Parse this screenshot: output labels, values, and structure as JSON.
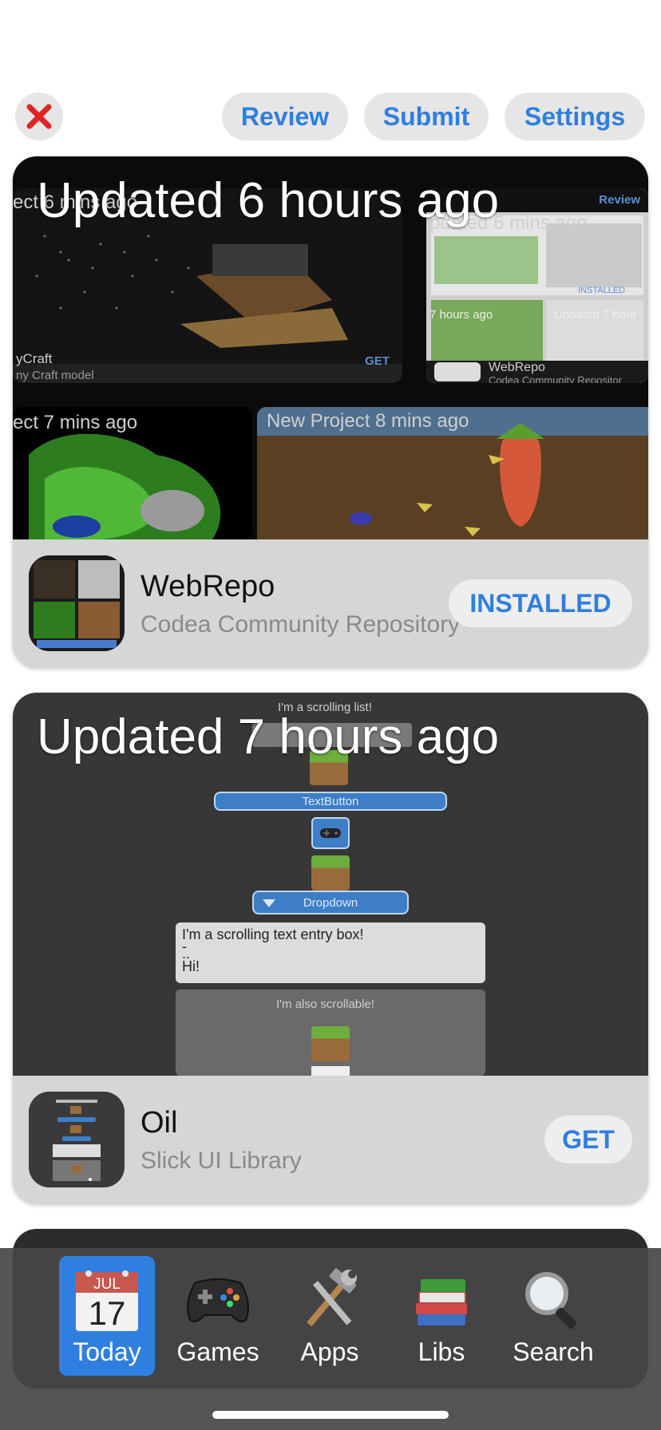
{
  "topbar": {
    "review_label": "Review",
    "submit_label": "Submit",
    "settings_label": "Settings",
    "close_icon": "close-x-icon",
    "accent": "#2f7fe0",
    "close_color": "#e02424"
  },
  "cards": [
    {
      "hero_title": "Updated 6 hours ago",
      "app_name": "WebRepo",
      "app_subtitle": "Codea Community Repository",
      "action_label": "INSTALLED",
      "hero": {
        "tile1_label": "ect 6 mins ago",
        "tile1_app": "yCraft",
        "tile1_sub": "ny Craft model",
        "tile1_get": "GET",
        "tile2_label": "pdated 6 mins ago",
        "tile2_badge": "Review",
        "tile2_app": "WebRepo",
        "tile2_sub": "Codea Community Repositor",
        "tile2_installed": "INSTALLED",
        "tile2_small1": "7 hours ago",
        "tile2_small2": "Updated 7 hour",
        "tile3_label": "ect 7 mins ago",
        "tile4_label": "New Project 8 mins ago"
      }
    },
    {
      "hero_title": "Updated 7 hours ago",
      "app_name": "Oil",
      "app_subtitle": "Slick UI Library",
      "action_label": "GET",
      "hero": {
        "scroll_list_label": "I'm a scrolling list!",
        "text_button_label": "TextButton",
        "dropdown_label": "Dropdown",
        "textbox_line1": "I'm a scrolling text entry box!",
        "textbox_line2": "-",
        "textbox_line3": "..",
        "textbox_line4": "Hi!",
        "scrollable_label": "I'm also scrollable!"
      }
    }
  ],
  "calendar": {
    "month": "JUL",
    "day": "17"
  },
  "tabs": [
    {
      "label": "Today",
      "icon": "calendar-icon",
      "active": true
    },
    {
      "label": "Games",
      "icon": "gamepad-icon",
      "active": false
    },
    {
      "label": "Apps",
      "icon": "hammer-wrench-icon",
      "active": false
    },
    {
      "label": "Libs",
      "icon": "books-icon",
      "active": false
    },
    {
      "label": "Search",
      "icon": "magnifying-glass-icon",
      "active": false
    }
  ]
}
